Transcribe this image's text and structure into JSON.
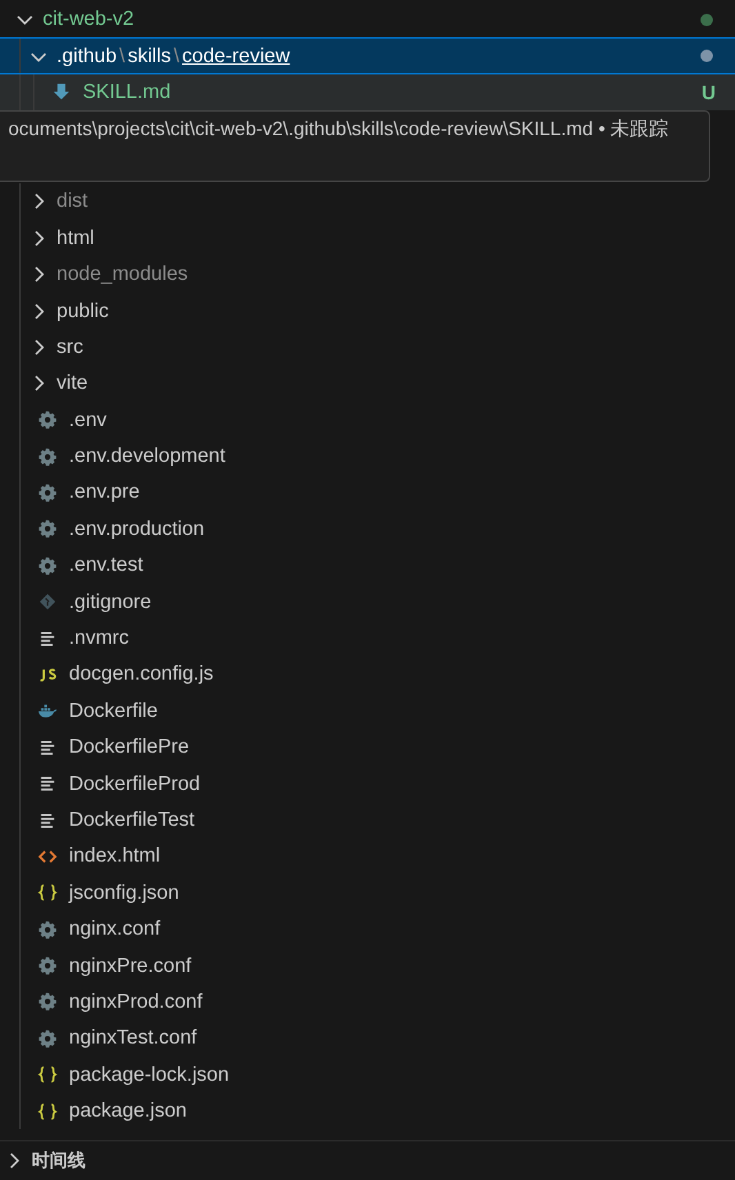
{
  "explorer": {
    "tree": [
      {
        "name": "cit-web-v2",
        "kind": "folder",
        "expanded": true,
        "untracked": true,
        "color": "#3b6e4b",
        "children": [
          {
            "kind": "folder",
            "expanded": true,
            "selected": true,
            "color": "#7d93a8",
            "parts": [
              {
                "text": ".github",
                "kind": "name"
              },
              {
                "text": "\\",
                "kind": "sep"
              },
              {
                "text": "skills",
                "kind": "name"
              },
              {
                "text": "\\",
                "kind": "sep"
              },
              {
                "text": "code-review",
                "kind": "active"
              }
            ],
            "children": [
              {
                "name": "SKILL.md",
                "kind": "markdown",
                "hovered": true,
                "untracked": true,
                "badge": "U",
                "tooltip": "ocuments\\projects\\cit\\cit-web-v2\\.github\\skills\\code-review\\SKILL.md • 未跟踪"
              }
            ]
          },
          {
            "name": "dist",
            "kind": "folder",
            "expanded": false,
            "dimmed": true
          },
          {
            "name": "html",
            "kind": "folder",
            "expanded": false
          },
          {
            "name": "node_modules",
            "kind": "folder",
            "expanded": false,
            "dimmed": true
          },
          {
            "name": "public",
            "kind": "folder",
            "expanded": false
          },
          {
            "name": "src",
            "kind": "folder",
            "expanded": false
          },
          {
            "name": "vite",
            "kind": "folder",
            "expanded": false
          },
          {
            "name": ".env",
            "kind": "config"
          },
          {
            "name": ".env.development",
            "kind": "config"
          },
          {
            "name": ".env.pre",
            "kind": "config"
          },
          {
            "name": ".env.production",
            "kind": "config"
          },
          {
            "name": ".env.test",
            "kind": "config"
          },
          {
            "name": ".gitignore",
            "kind": "git"
          },
          {
            "name": ".nvmrc",
            "kind": "text"
          },
          {
            "name": "docgen.config.js",
            "kind": "js"
          },
          {
            "name": "Dockerfile",
            "kind": "docker"
          },
          {
            "name": "DockerfilePre",
            "kind": "text"
          },
          {
            "name": "DockerfileProd",
            "kind": "text"
          },
          {
            "name": "DockerfileTest",
            "kind": "text"
          },
          {
            "name": "index.html",
            "kind": "html"
          },
          {
            "name": "jsconfig.json",
            "kind": "json"
          },
          {
            "name": "nginx.conf",
            "kind": "config"
          },
          {
            "name": "nginxPre.conf",
            "kind": "config"
          },
          {
            "name": "nginxProd.conf",
            "kind": "config"
          },
          {
            "name": "nginxTest.conf",
            "kind": "config"
          },
          {
            "name": "package-lock.json",
            "kind": "json"
          },
          {
            "name": "package.json",
            "kind": "json"
          }
        ]
      }
    ]
  },
  "timeline": {
    "title": "时间线",
    "expanded": false
  }
}
